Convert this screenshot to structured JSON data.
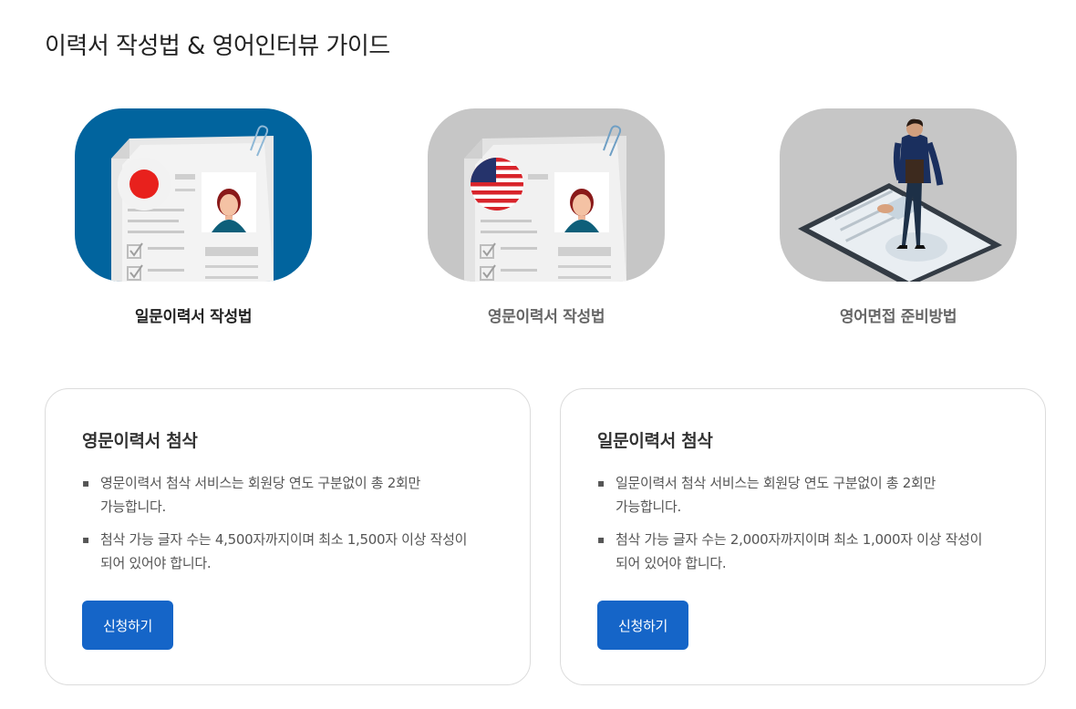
{
  "page": {
    "title": "이력서 작성법 & 영어인터뷰 가이드"
  },
  "colors": {
    "accent": "#1565c8",
    "active_tab_bg": "#01649e",
    "inactive_tab_bg": "#c6c6c6"
  },
  "tabs": [
    {
      "label": "일문이력서 작성법",
      "icon": "japanese-resume-illustration",
      "active": true
    },
    {
      "label": "영문이력서 작성법",
      "icon": "english-resume-illustration",
      "active": false
    },
    {
      "label": "영어면접 준비방법",
      "icon": "english-interview-illustration",
      "active": false
    }
  ],
  "cards": [
    {
      "title": "영문이력서 첨삭",
      "items": [
        {
          "line1": "영문이력서 첨삭 서비스는 회원당 연도 구분없이 총 2회만",
          "line2": "가능합니다."
        },
        {
          "line1": "첨삭 가능 글자 수는 4,500자까지이며 최소 1,500자 이상 작성이",
          "line2": "되어 있어야 합니다."
        }
      ],
      "button_label": "신청하기"
    },
    {
      "title": "일문이력서 첨삭",
      "items": [
        {
          "line1": "일문이력서 첨삭 서비스는 회원당 연도 구분없이 총 2회만",
          "line2": "가능합니다."
        },
        {
          "line1": "첨삭 가능 글자 수는 2,000자까지이며 최소 1,000자 이상 작성이",
          "line2": "되어 있어야 합니다."
        }
      ],
      "button_label": "신청하기"
    }
  ]
}
